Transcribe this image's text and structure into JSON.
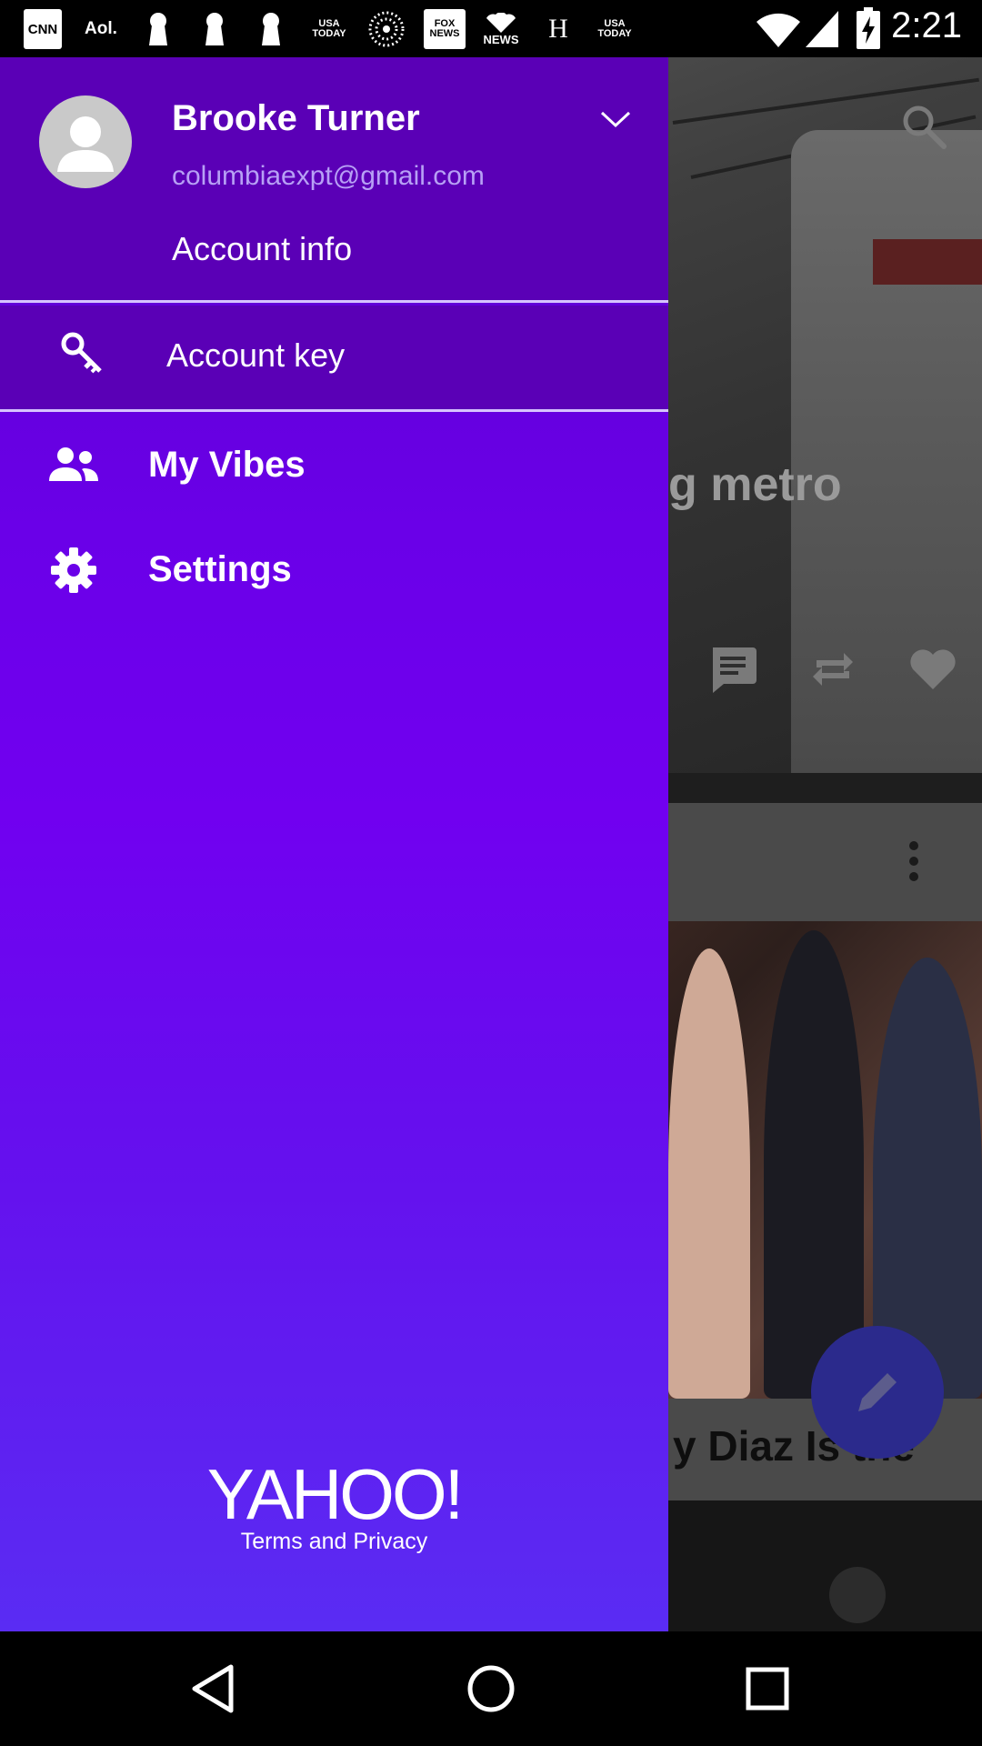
{
  "status_bar": {
    "time": "2:21",
    "notifications": [
      "CNN",
      "Aol.",
      "USA TODAY",
      "FOX NEWS",
      "NEWS",
      "H",
      "USA TODAY"
    ],
    "icons": [
      "wifi-icon",
      "signal-icon",
      "battery-charging-icon"
    ]
  },
  "drawer": {
    "user_name": "Brooke Turner",
    "user_email": "columbiaexpt@gmail.com",
    "account_info": "Account info",
    "account_key": "Account key",
    "menu": [
      {
        "label": "My Vibes",
        "icon": "people-icon"
      },
      {
        "label": "Settings",
        "icon": "gear-icon"
      }
    ],
    "logo_text": "YAHOO!",
    "terms_link": "Terms and Privacy"
  },
  "background_app": {
    "hero_title_fragment": "g metro",
    "card_title_fragment": "y Diaz Is the"
  },
  "colors": {
    "drawer_top": "#5a00b6",
    "drawer_gradient": [
      "#5a00c8",
      "#7100f0",
      "#5a2cf3"
    ],
    "divider": "#d7c4ff",
    "email_text": "#b7a0f5"
  }
}
